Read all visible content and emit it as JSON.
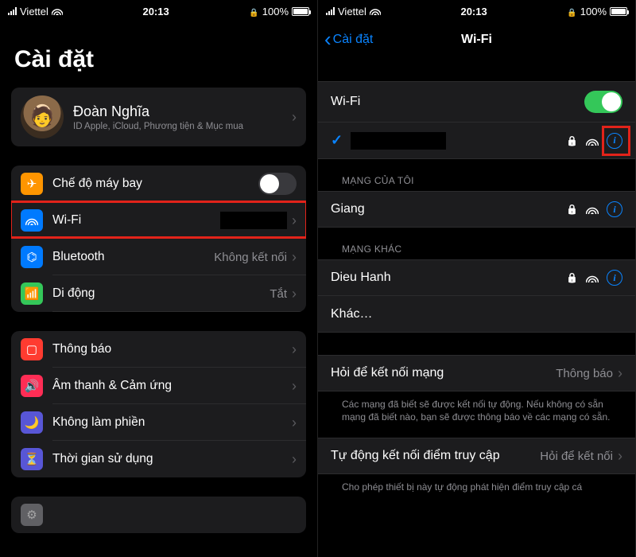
{
  "status": {
    "carrier": "Viettel",
    "time": "20:13",
    "battery_pct": "100%"
  },
  "left": {
    "title": "Cài đặt",
    "profile": {
      "name": "Đoàn Nghĩa",
      "subtitle": "ID Apple, iCloud, Phương tiện & Mục mua"
    },
    "rows": {
      "airplane": "Chế độ máy bay",
      "wifi": "Wi-Fi",
      "bluetooth": "Bluetooth",
      "bluetooth_value": "Không kết nối",
      "cellular": "Di động",
      "cellular_value": "Tắt",
      "notifications": "Thông báo",
      "sounds": "Âm thanh & Cảm ứng",
      "dnd": "Không làm phiền",
      "screentime": "Thời gian sử dụng"
    }
  },
  "right": {
    "back": "Cài đặt",
    "title": "Wi-Fi",
    "wifi_label": "Wi-Fi",
    "section_mynet": "MẠNG CỦA TÔI",
    "net_giang": "Giang",
    "section_other": "MẠNG KHÁC",
    "net_dieuhanh": "Dieu Hanh",
    "other": "Khác…",
    "ask_join": "Hỏi để kết nối mạng",
    "ask_join_value": "Thông báo",
    "ask_join_footer": "Các mạng đã biết sẽ được kết nối tự động. Nếu không có sẵn mạng đã biết nào, bạn sẽ được thông báo về các mạng có sẵn.",
    "auto_hotspot": "Tự động kết nối điểm truy cập",
    "auto_hotspot_value": "Hỏi để kết nối",
    "auto_hotspot_footer": "Cho phép thiết bị này tự động phát hiện điểm truy cập cá"
  }
}
